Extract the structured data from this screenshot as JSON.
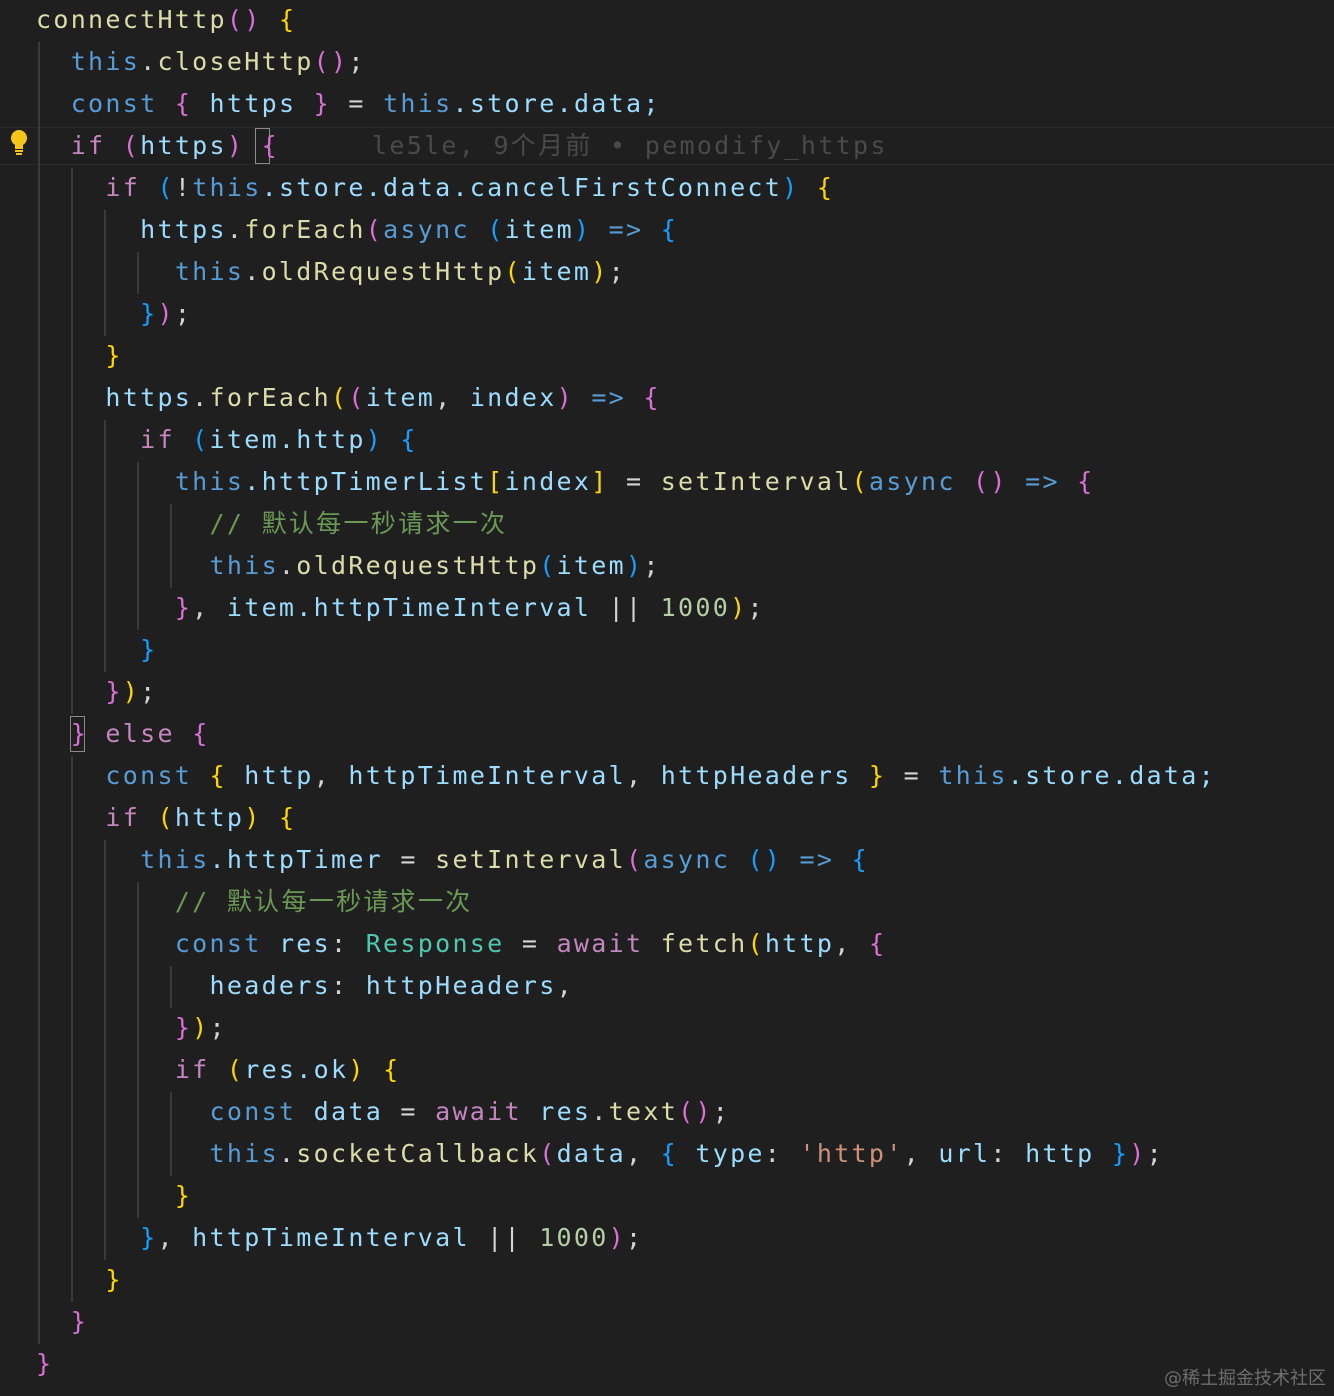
{
  "editor": {
    "blame_annotation": "le5le, 9个月前 • pemodify_https",
    "watermark": "@稀土掘金技术社区",
    "lightbulb_icon": "lightbulb-icon",
    "colors": {
      "background": "#1f1f1f",
      "keyword": "#569cd6",
      "control": "#c586c0",
      "function": "#dcdcaa",
      "variable": "#9cdcfe",
      "type": "#4ec9b0",
      "string": "#ce9178",
      "number": "#b5cea8",
      "comment": "#6a9955",
      "bracket_gold": "#ffd700",
      "bracket_orchid": "#da70d6",
      "bracket_blue": "#179fff"
    }
  },
  "code": {
    "lines": [
      [
        [
          "connectHttp",
          "fn"
        ],
        [
          "() ",
          "b2"
        ],
        [
          "{",
          "b1"
        ]
      ],
      [
        [
          "  ",
          "op"
        ],
        [
          "this",
          "kw"
        ],
        [
          ".",
          "op"
        ],
        [
          "closeHttp",
          "fn"
        ],
        [
          "()",
          "b2"
        ],
        [
          ";",
          "op"
        ]
      ],
      [
        [
          "  ",
          "op"
        ],
        [
          "const",
          "kw"
        ],
        [
          " ",
          "op"
        ],
        [
          "{",
          "b2"
        ],
        [
          " https ",
          "var"
        ],
        [
          "}",
          "b2"
        ],
        [
          " = ",
          "op"
        ],
        [
          "this",
          "kw"
        ],
        [
          ".store.data;",
          "var"
        ]
      ],
      [
        [
          "  ",
          "op"
        ],
        [
          "if",
          "ctl"
        ],
        [
          " ",
          "op"
        ],
        [
          "(",
          "b2"
        ],
        [
          "https",
          "var"
        ],
        [
          ")",
          "b2"
        ],
        [
          " ",
          "op"
        ],
        [
          "{",
          "b2"
        ]
      ],
      [
        [
          "    ",
          "op"
        ],
        [
          "if",
          "ctl"
        ],
        [
          " ",
          "op"
        ],
        [
          "(",
          "b3"
        ],
        [
          "!",
          "op"
        ],
        [
          "this",
          "kw"
        ],
        [
          ".store.data.cancelFirstConnect",
          "var"
        ],
        [
          ")",
          "b3"
        ],
        [
          " ",
          "op"
        ],
        [
          "{",
          "b1"
        ]
      ],
      [
        [
          "      ",
          "op"
        ],
        [
          "https",
          "var"
        ],
        [
          ".",
          "op"
        ],
        [
          "forEach",
          "fn"
        ],
        [
          "(",
          "b2"
        ],
        [
          "async",
          "kw"
        ],
        [
          " ",
          "op"
        ],
        [
          "(",
          "b3"
        ],
        [
          "item",
          "var"
        ],
        [
          ")",
          "b3"
        ],
        [
          " ",
          "op"
        ],
        [
          "=>",
          "kw"
        ],
        [
          " ",
          "op"
        ],
        [
          "{",
          "b3"
        ]
      ],
      [
        [
          "        ",
          "op"
        ],
        [
          "this",
          "kw"
        ],
        [
          ".",
          "op"
        ],
        [
          "oldRequestHttp",
          "fn"
        ],
        [
          "(",
          "b1"
        ],
        [
          "item",
          "var"
        ],
        [
          ")",
          "b1"
        ],
        [
          ";",
          "op"
        ]
      ],
      [
        [
          "      ",
          "op"
        ],
        [
          "}",
          "b3"
        ],
        [
          ")",
          "b2"
        ],
        [
          ";",
          "op"
        ]
      ],
      [
        [
          "    ",
          "op"
        ],
        [
          "}",
          "b1"
        ]
      ],
      [
        [
          "    ",
          "op"
        ],
        [
          "https",
          "var"
        ],
        [
          ".",
          "op"
        ],
        [
          "forEach",
          "fn"
        ],
        [
          "(",
          "b1"
        ],
        [
          "(",
          "b2"
        ],
        [
          "item",
          "var"
        ],
        [
          ", ",
          "op"
        ],
        [
          "index",
          "var"
        ],
        [
          ")",
          "b2"
        ],
        [
          " ",
          "op"
        ],
        [
          "=>",
          "kw"
        ],
        [
          " ",
          "op"
        ],
        [
          "{",
          "b2"
        ]
      ],
      [
        [
          "      ",
          "op"
        ],
        [
          "if",
          "ctl"
        ],
        [
          " ",
          "op"
        ],
        [
          "(",
          "b3"
        ],
        [
          "item.http",
          "var"
        ],
        [
          ")",
          "b3"
        ],
        [
          " ",
          "op"
        ],
        [
          "{",
          "b3"
        ]
      ],
      [
        [
          "        ",
          "op"
        ],
        [
          "this",
          "kw"
        ],
        [
          ".httpTimerList",
          "var"
        ],
        [
          "[",
          "b1"
        ],
        [
          "index",
          "var"
        ],
        [
          "]",
          "b1"
        ],
        [
          " = ",
          "op"
        ],
        [
          "setInterval",
          "fn"
        ],
        [
          "(",
          "b1"
        ],
        [
          "async",
          "kw"
        ],
        [
          " ",
          "op"
        ],
        [
          "()",
          "b2"
        ],
        [
          " ",
          "op"
        ],
        [
          "=>",
          "kw"
        ],
        [
          " ",
          "op"
        ],
        [
          "{",
          "b2"
        ]
      ],
      [
        [
          "          ",
          "op"
        ],
        [
          "// 默认每一秒请求一次",
          "cmt"
        ]
      ],
      [
        [
          "          ",
          "op"
        ],
        [
          "this",
          "kw"
        ],
        [
          ".",
          "op"
        ],
        [
          "oldRequestHttp",
          "fn"
        ],
        [
          "(",
          "b3"
        ],
        [
          "item",
          "var"
        ],
        [
          ")",
          "b3"
        ],
        [
          ";",
          "op"
        ]
      ],
      [
        [
          "        ",
          "op"
        ],
        [
          "}",
          "b2"
        ],
        [
          ", ",
          "op"
        ],
        [
          "item.httpTimeInterval",
          "var"
        ],
        [
          " || ",
          "op"
        ],
        [
          "1000",
          "num"
        ],
        [
          ")",
          "b1"
        ],
        [
          ";",
          "op"
        ]
      ],
      [
        [
          "      ",
          "op"
        ],
        [
          "}",
          "b3"
        ]
      ],
      [
        [
          "    ",
          "op"
        ],
        [
          "}",
          "b2"
        ],
        [
          ")",
          "b1"
        ],
        [
          ";",
          "op"
        ]
      ],
      [
        [
          "  ",
          "op"
        ],
        [
          "}",
          "b2"
        ],
        [
          " ",
          "op"
        ],
        [
          "else",
          "ctl"
        ],
        [
          " ",
          "op"
        ],
        [
          "{",
          "b2"
        ]
      ],
      [
        [
          "    ",
          "op"
        ],
        [
          "const",
          "kw"
        ],
        [
          " ",
          "op"
        ],
        [
          "{",
          "b1"
        ],
        [
          " http",
          "var"
        ],
        [
          ", ",
          "op"
        ],
        [
          "httpTimeInterval",
          "var"
        ],
        [
          ", ",
          "op"
        ],
        [
          "httpHeaders ",
          "var"
        ],
        [
          "}",
          "b1"
        ],
        [
          " = ",
          "op"
        ],
        [
          "this",
          "kw"
        ],
        [
          ".store.data;",
          "var"
        ]
      ],
      [
        [
          "    ",
          "op"
        ],
        [
          "if",
          "ctl"
        ],
        [
          " ",
          "op"
        ],
        [
          "(",
          "b1"
        ],
        [
          "http",
          "var"
        ],
        [
          ")",
          "b1"
        ],
        [
          " ",
          "op"
        ],
        [
          "{",
          "b1"
        ]
      ],
      [
        [
          "      ",
          "op"
        ],
        [
          "this",
          "kw"
        ],
        [
          ".httpTimer",
          "var"
        ],
        [
          " = ",
          "op"
        ],
        [
          "setInterval",
          "fn"
        ],
        [
          "(",
          "b2"
        ],
        [
          "async",
          "kw"
        ],
        [
          " ",
          "op"
        ],
        [
          "()",
          "b3"
        ],
        [
          " ",
          "op"
        ],
        [
          "=>",
          "kw"
        ],
        [
          " ",
          "op"
        ],
        [
          "{",
          "b3"
        ]
      ],
      [
        [
          "        ",
          "op"
        ],
        [
          "// 默认每一秒请求一次",
          "cmt"
        ]
      ],
      [
        [
          "        ",
          "op"
        ],
        [
          "const",
          "kw"
        ],
        [
          " ",
          "op"
        ],
        [
          "res",
          "var"
        ],
        [
          ": ",
          "op"
        ],
        [
          "Response",
          "typ"
        ],
        [
          " = ",
          "op"
        ],
        [
          "await",
          "ctl"
        ],
        [
          " ",
          "op"
        ],
        [
          "fetch",
          "fn"
        ],
        [
          "(",
          "b1"
        ],
        [
          "http",
          "var"
        ],
        [
          ", ",
          "op"
        ],
        [
          "{",
          "b2"
        ]
      ],
      [
        [
          "          ",
          "op"
        ],
        [
          "headers",
          "var"
        ],
        [
          ": ",
          "op"
        ],
        [
          "httpHeaders",
          "var"
        ],
        [
          ",",
          "op"
        ]
      ],
      [
        [
          "        ",
          "op"
        ],
        [
          "}",
          "b2"
        ],
        [
          ")",
          "b1"
        ],
        [
          ";",
          "op"
        ]
      ],
      [
        [
          "        ",
          "op"
        ],
        [
          "if",
          "ctl"
        ],
        [
          " ",
          "op"
        ],
        [
          "(",
          "b1"
        ],
        [
          "res.ok",
          "var"
        ],
        [
          ")",
          "b1"
        ],
        [
          " ",
          "op"
        ],
        [
          "{",
          "b1"
        ]
      ],
      [
        [
          "          ",
          "op"
        ],
        [
          "const",
          "kw"
        ],
        [
          " ",
          "op"
        ],
        [
          "data",
          "var"
        ],
        [
          " = ",
          "op"
        ],
        [
          "await",
          "ctl"
        ],
        [
          " ",
          "op"
        ],
        [
          "res",
          "var"
        ],
        [
          ".",
          "op"
        ],
        [
          "text",
          "fn"
        ],
        [
          "()",
          "b2"
        ],
        [
          ";",
          "op"
        ]
      ],
      [
        [
          "          ",
          "op"
        ],
        [
          "this",
          "kw"
        ],
        [
          ".",
          "op"
        ],
        [
          "socketCallback",
          "fn"
        ],
        [
          "(",
          "b2"
        ],
        [
          "data",
          "var"
        ],
        [
          ", ",
          "op"
        ],
        [
          "{",
          "b3"
        ],
        [
          " type",
          "var"
        ],
        [
          ": ",
          "op"
        ],
        [
          "'http'",
          "str"
        ],
        [
          ", ",
          "op"
        ],
        [
          "url",
          "var"
        ],
        [
          ": ",
          "op"
        ],
        [
          "http ",
          "var"
        ],
        [
          "}",
          "b3"
        ],
        [
          ")",
          "b2"
        ],
        [
          ";",
          "op"
        ]
      ],
      [
        [
          "        ",
          "op"
        ],
        [
          "}",
          "b1"
        ]
      ],
      [
        [
          "      ",
          "op"
        ],
        [
          "}",
          "b3"
        ],
        [
          ", ",
          "op"
        ],
        [
          "httpTimeInterval",
          "var"
        ],
        [
          " || ",
          "op"
        ],
        [
          "1000",
          "num"
        ],
        [
          ")",
          "b2"
        ],
        [
          ";",
          "op"
        ]
      ],
      [
        [
          "    ",
          "op"
        ],
        [
          "}",
          "b1"
        ]
      ],
      [
        [
          "  ",
          "op"
        ],
        [
          "}",
          "b2"
        ]
      ],
      [
        [
          "}",
          "b2"
        ]
      ]
    ]
  }
}
